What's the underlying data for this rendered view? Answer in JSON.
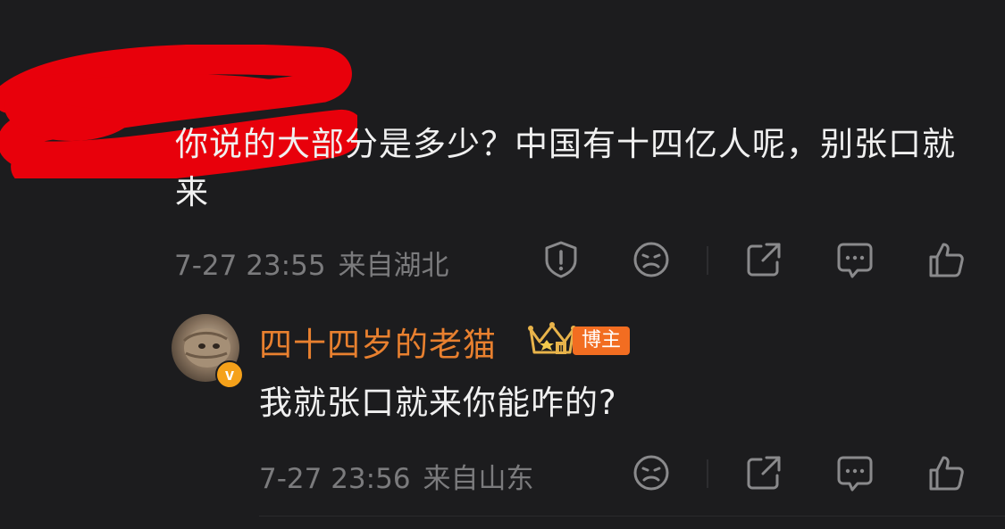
{
  "comment": {
    "text": "你说的大部分是多少？中国有十四亿人呢，别张口就来",
    "time": "7-27 23:55",
    "location": "来自湖北",
    "actions": [
      "report-icon",
      "dislike-icon",
      "share-icon",
      "reply-icon",
      "like-icon"
    ]
  },
  "reply": {
    "username": "四十四岁的老猫",
    "badge": "博主",
    "verified_mark": "v",
    "text": "我就张口就来你能咋的?",
    "time": "7-27 23:56",
    "location": "来自山东",
    "actions": [
      "dislike-icon",
      "share-icon",
      "reply-icon",
      "like-icon"
    ]
  },
  "colors": {
    "background": "#1c1c1e",
    "text": "#f0f0f0",
    "meta": "#7b7b7d",
    "username": "#e8802f",
    "badge": "#f26d21",
    "redaction": "#e8000b"
  }
}
